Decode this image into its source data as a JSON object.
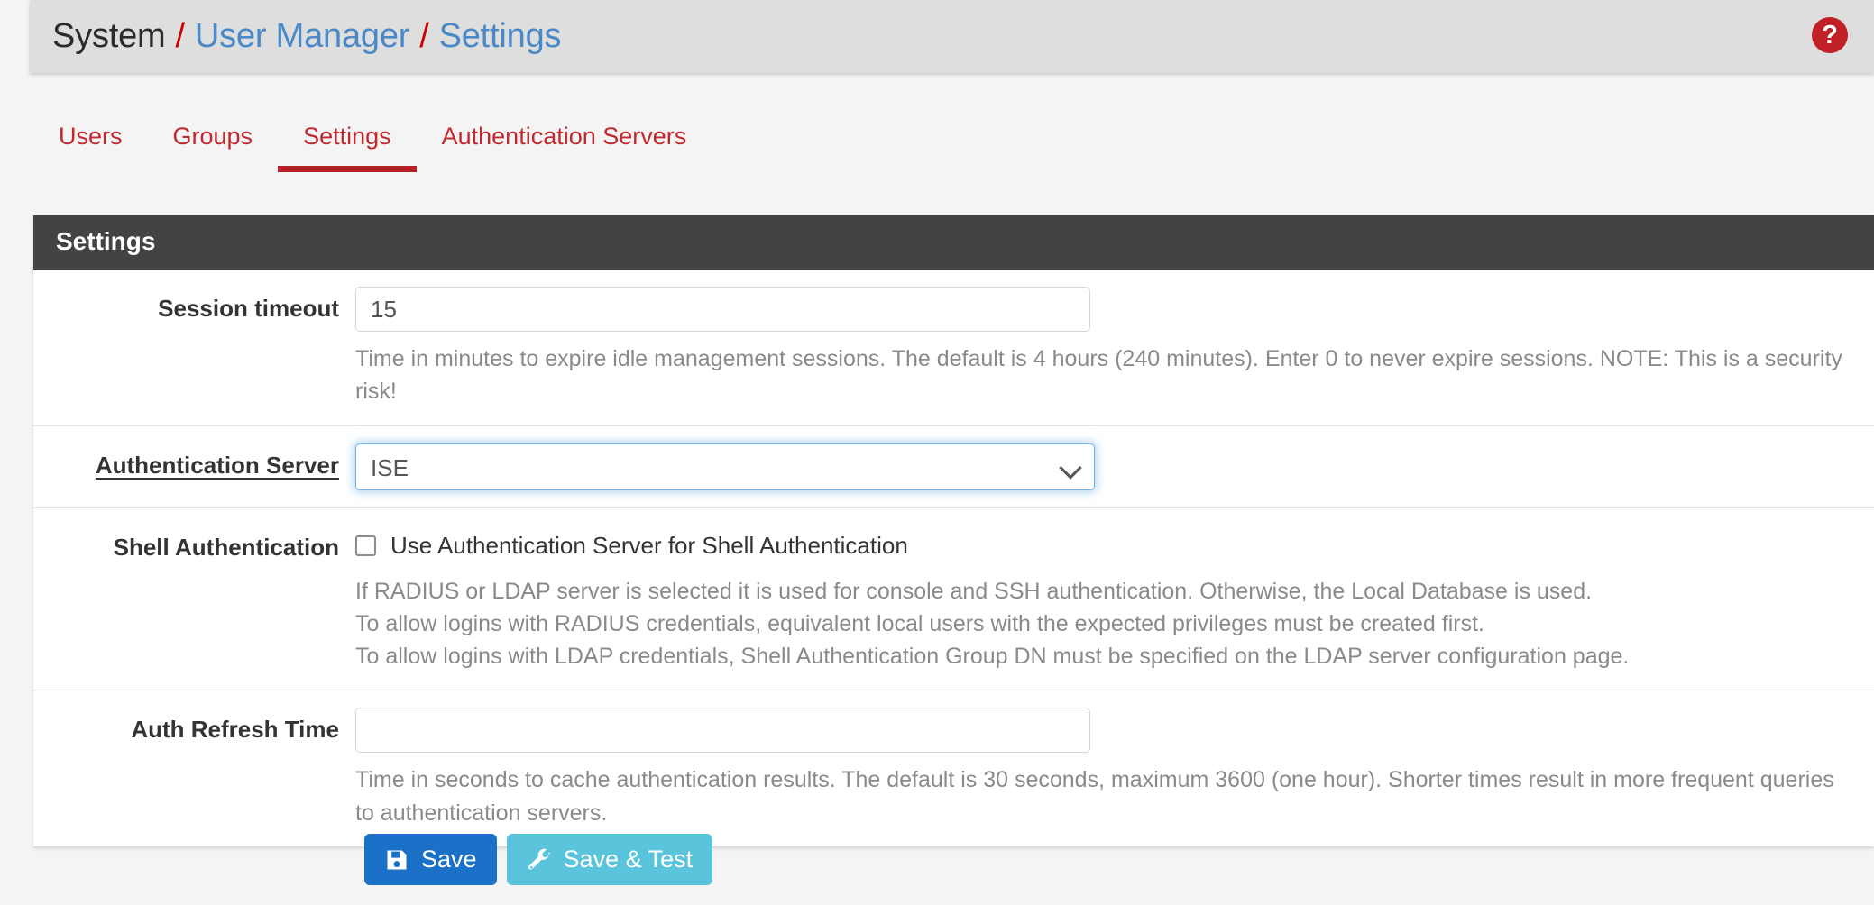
{
  "breadcrumb": {
    "root": "System",
    "sep": "/",
    "link1": "User Manager",
    "link2": "Settings",
    "help_icon": "help-circle-icon",
    "help_glyph": "?"
  },
  "tabs": [
    {
      "label": "Users",
      "active": false
    },
    {
      "label": "Groups",
      "active": false
    },
    {
      "label": "Settings",
      "active": true
    },
    {
      "label": "Authentication Servers",
      "active": false
    }
  ],
  "panel": {
    "heading": "Settings",
    "rows": {
      "session_timeout": {
        "label": "Session timeout",
        "value": "15",
        "placeholder": "",
        "help1": "Time in minutes to expire idle management sessions. The default is 4 hours (240 minutes). Enter 0 to never expire sessions. NOTE: This is a security risk!"
      },
      "auth_server": {
        "label": "Authentication Server",
        "value": "ISE",
        "chevron_icon": "chevron-down-icon"
      },
      "shell_auth": {
        "label": "Shell Authentication",
        "checkbox_label": "Use Authentication Server for Shell Authentication",
        "checked": false,
        "help1": "If RADIUS or LDAP server is selected it is used for console and SSH authentication. Otherwise, the Local Database is used.",
        "help2": "To allow logins with RADIUS credentials, equivalent local users with the expected privileges must be created first.",
        "help3": "To allow logins with LDAP credentials, Shell Authentication Group DN must be specified on the LDAP server configuration page."
      },
      "auth_refresh": {
        "label": "Auth Refresh Time",
        "value": "",
        "placeholder": "",
        "help1": "Time in seconds to cache authentication results. The default is 30 seconds, maximum 3600 (one hour). Shorter times result in more frequent queries to authentication servers."
      }
    }
  },
  "buttons": {
    "save": {
      "label": "Save",
      "icon": "save-floppy-icon",
      "color": "#1b70c8"
    },
    "save_test": {
      "label": "Save & Test",
      "icon": "wrench-icon",
      "color": "#5bc4dd"
    }
  },
  "colors": {
    "page_background": "#f4f4f4",
    "header_background": "#dedede",
    "panel_heading_background": "#434343",
    "tab_red": "#c2282d",
    "breadcrumb_link": "#4a89c8",
    "breadcrumb_separator": "#cc0000",
    "focus_blue": "#6cb1ec"
  }
}
